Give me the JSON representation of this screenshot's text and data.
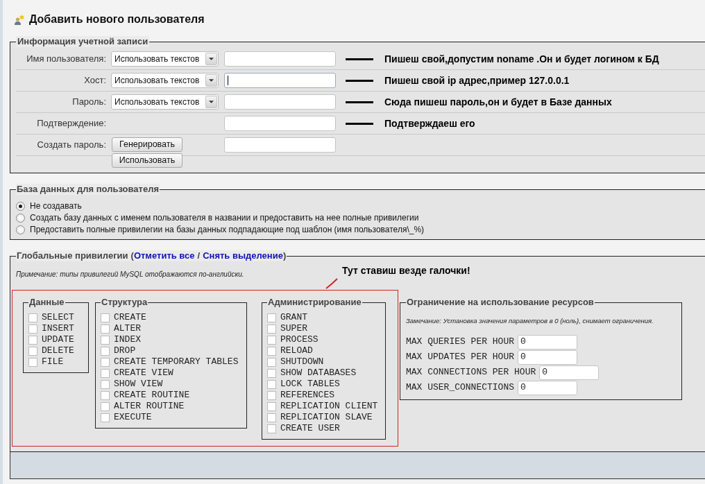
{
  "page_title": "Добавить нового пользователя",
  "account_info": {
    "legend": "Информация учетной записи",
    "rows": [
      {
        "kind": "select_field",
        "label": "Имя пользователя:",
        "select": "Использовать текстов",
        "focused": false,
        "annotation": "Пишеш свой,допустим noname .Он и будет логином к БД"
      },
      {
        "kind": "select_field",
        "label": "Хост:",
        "select": "Использовать текстов",
        "focused": true,
        "annotation": "Пишеш свой ip адрес,пример 127.0.0.1"
      },
      {
        "kind": "select_field",
        "label": "Пароль:",
        "select": "Использовать текстов",
        "focused": false,
        "annotation": "Сюда пишеш пароль,он и будет в Базе данных"
      },
      {
        "kind": "field",
        "label": "Подтверждение:",
        "focused": false,
        "annotation": "Подтверждаеш его"
      },
      {
        "kind": "generate",
        "label": "Создать пароль:",
        "buttons": [
          "Генерировать",
          "Использовать"
        ],
        "focused": false
      }
    ]
  },
  "database": {
    "legend": "База данных для пользователя",
    "options": [
      {
        "label": "Не создавать",
        "selected": true
      },
      {
        "label": "Создать базу данных с именем пользователя в названии и предоставить на нее полные привилегии",
        "selected": false
      },
      {
        "label": "Предоставить полные привилегии на базы данных подпадающие под шаблон (имя пользователя\\_%)",
        "selected": false
      }
    ]
  },
  "global_privileges": {
    "title": "Глобальные привилегии",
    "open_bracket": "(",
    "links": [
      "Отметить все",
      "Снять выделение"
    ],
    "separator": "/",
    "close_bracket": ")",
    "note": "Примечание: типы привилегий MySQL отображаются по-английски.",
    "annotation": "Тут ставиш везде галочки!",
    "groups": [
      {
        "legend": "Данные",
        "items": [
          {
            "label": "SELECT",
            "checked": false
          },
          {
            "label": "INSERT",
            "checked": false
          },
          {
            "label": "UPDATE",
            "checked": false
          },
          {
            "label": "DELETE",
            "checked": false
          },
          {
            "label": "FILE",
            "checked": false
          }
        ]
      },
      {
        "legend": "Структура",
        "items": [
          {
            "label": "CREATE",
            "checked": false
          },
          {
            "label": "ALTER",
            "checked": false
          },
          {
            "label": "INDEX",
            "checked": false
          },
          {
            "label": "DROP",
            "checked": false
          },
          {
            "label": "CREATE TEMPORARY TABLES",
            "checked": false
          },
          {
            "label": "CREATE VIEW",
            "checked": false
          },
          {
            "label": "SHOW VIEW",
            "checked": false
          },
          {
            "label": "CREATE ROUTINE",
            "checked": false
          },
          {
            "label": "ALTER ROUTINE",
            "checked": false
          },
          {
            "label": "EXECUTE",
            "checked": false
          }
        ]
      },
      {
        "legend": "Администрирование",
        "items": [
          {
            "label": "GRANT",
            "checked": false
          },
          {
            "label": "SUPER",
            "checked": false
          },
          {
            "label": "PROCESS",
            "checked": false
          },
          {
            "label": "RELOAD",
            "checked": false
          },
          {
            "label": "SHUTDOWN",
            "checked": false
          },
          {
            "label": "SHOW DATABASES",
            "checked": false
          },
          {
            "label": "LOCK TABLES",
            "checked": false
          },
          {
            "label": "REFERENCES",
            "checked": false
          },
          {
            "label": "REPLICATION CLIENT",
            "checked": false
          },
          {
            "label": "REPLICATION SLAVE",
            "checked": false
          },
          {
            "label": "CREATE USER",
            "checked": false
          }
        ]
      }
    ],
    "resource_limits": {
      "legend": "Ограничение на использование ресурсов",
      "note": "Замечание: Установка значения параметров в 0 (ноль), снимает ограничения.",
      "fields": [
        {
          "label": "MAX QUERIES PER HOUR",
          "value": "0"
        },
        {
          "label": "MAX UPDATES PER HOUR",
          "value": "0"
        },
        {
          "label": "MAX CONNECTIONS PER HOUR",
          "value": "0"
        },
        {
          "label": "MAX USER_CONNECTIONS",
          "value": "0"
        }
      ]
    }
  }
}
